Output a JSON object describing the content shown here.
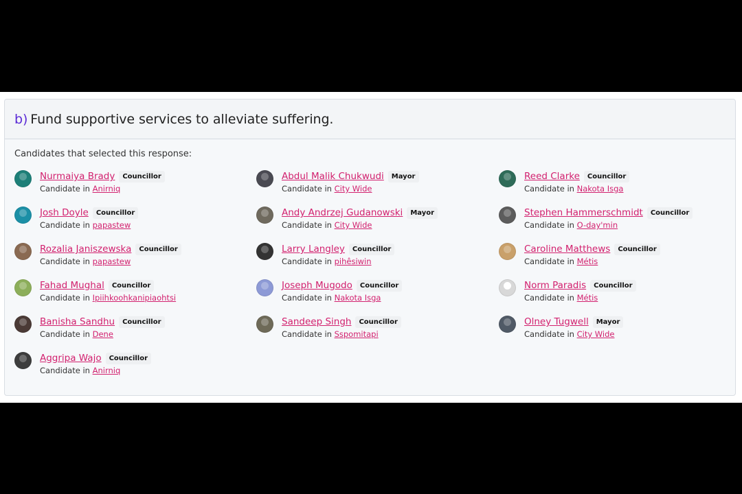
{
  "question": {
    "letter": "b)",
    "text": "Fund supportive services to alleviate suffering."
  },
  "intro": "Candidates that selected this response:",
  "candidate_in_label": "Candidate in",
  "candidates": [
    {
      "name": "Nurmaiya Brady",
      "role": "Councillor",
      "ward": "Anirniq",
      "avatar_color": "#1d7f78"
    },
    {
      "name": "Abdul Malik Chukwudi",
      "role": "Mayor",
      "ward": "City Wide",
      "avatar_color": "#4a4a52"
    },
    {
      "name": "Reed Clarke",
      "role": "Councillor",
      "ward": "Nakota Isga",
      "avatar_color": "#2e6b58"
    },
    {
      "name": "Josh Doyle",
      "role": "Councillor",
      "ward": "papastew",
      "avatar_color": "#1b8fa6"
    },
    {
      "name": "Andy Andrzej Gudanowski",
      "role": "Mayor",
      "ward": "City Wide",
      "avatar_color": "#6f6a5e"
    },
    {
      "name": "Stephen Hammerschmidt",
      "role": "Councillor",
      "ward": "O-day'min",
      "avatar_color": "#5c5c5c"
    },
    {
      "name": "Rozalia Janiszewska",
      "role": "Councillor",
      "ward": "papastew",
      "avatar_color": "#8a6a52"
    },
    {
      "name": "Larry Langley",
      "role": "Councillor",
      "ward": "pihêsiwin",
      "avatar_color": "#333333"
    },
    {
      "name": "Caroline Matthews",
      "role": "Councillor",
      "ward": "Métis",
      "avatar_color": "#c9a06a"
    },
    {
      "name": "Fahad Mughal",
      "role": "Councillor",
      "ward": "Ipiihkoohkanipiaohtsi",
      "avatar_color": "#8cae5a"
    },
    {
      "name": "Joseph Mugodo",
      "role": "Councillor",
      "ward": "Nakota Isga",
      "avatar_color": "#8d9ad6"
    },
    {
      "name": "Norm Paradis",
      "role": "Councillor",
      "ward": "Métis",
      "avatar_color": "#d8d8d8",
      "blank": true
    },
    {
      "name": "Banisha Sandhu",
      "role": "Councillor",
      "ward": "Dene",
      "avatar_color": "#4a3a36"
    },
    {
      "name": "Sandeep Singh",
      "role": "Councillor",
      "ward": "Sspomitapi",
      "avatar_color": "#6e6a58"
    },
    {
      "name": "Olney Tugwell",
      "role": "Mayor",
      "ward": "City Wide",
      "avatar_color": "#505a66"
    },
    {
      "name": "Aggripa Wajo",
      "role": "Councillor",
      "ward": "Anirniq",
      "avatar_color": "#3d3d3d"
    }
  ]
}
